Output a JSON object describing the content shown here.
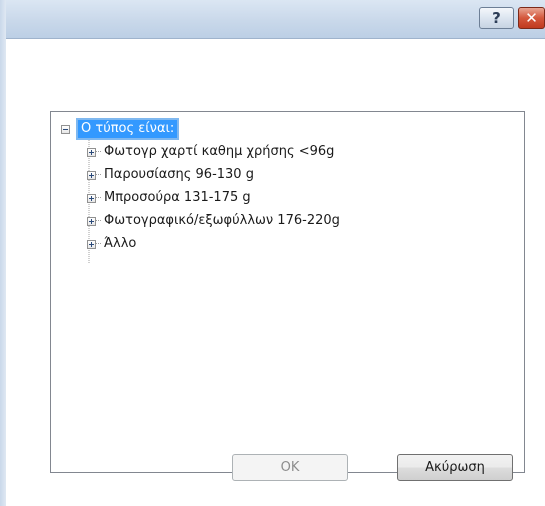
{
  "titlebar": {
    "help_label": "?",
    "close_label": "✕"
  },
  "tree": {
    "root": {
      "label": "Ο τύπος είναι:",
      "expanded": true,
      "selected": true
    },
    "items": [
      {
        "label": "Φωτογρ χαρτί καθημ χρήσης <96g"
      },
      {
        "label": "Παρουσίασης 96-130 g"
      },
      {
        "label": "Μπροσούρα 131-175 g"
      },
      {
        "label": "Φωτογραφικό/εξωφύλλων 176-220g"
      },
      {
        "label": "Άλλο"
      }
    ]
  },
  "buttons": {
    "ok_label": "OK",
    "cancel_label": "Ακύρωση"
  },
  "colors": {
    "selection": "#3399ff",
    "close_button": "#c03a1f",
    "titlebar": "#c9d8ea"
  }
}
